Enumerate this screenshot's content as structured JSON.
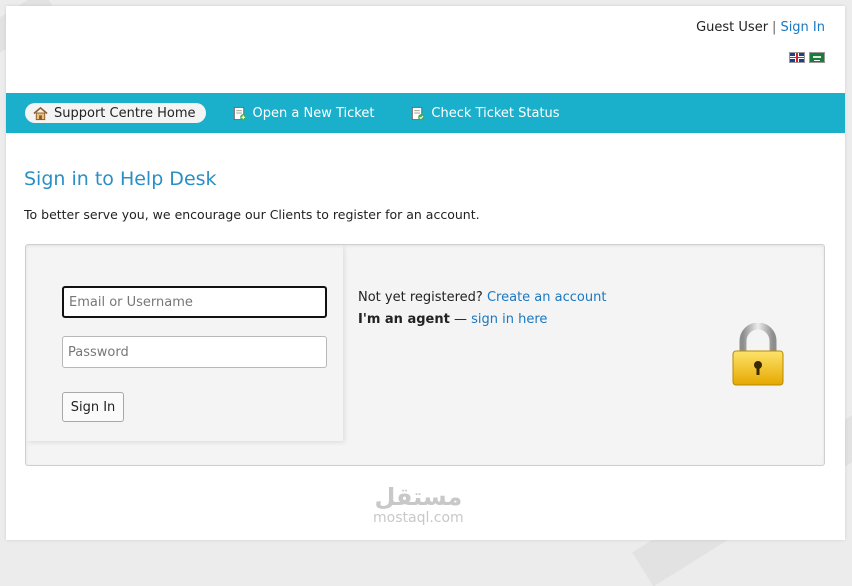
{
  "header": {
    "guest_label": "Guest User",
    "separator": "|",
    "signin_link": "Sign In"
  },
  "languages": [
    {
      "name": "uk-flag-icon"
    },
    {
      "name": "saudi-flag-icon"
    }
  ],
  "nav": {
    "items": [
      {
        "label": "Support Centre Home",
        "icon": "home-icon",
        "active": true
      },
      {
        "label": "Open a New Ticket",
        "icon": "new-ticket-icon",
        "active": false
      },
      {
        "label": "Check Ticket Status",
        "icon": "ticket-status-icon",
        "active": false
      }
    ]
  },
  "main": {
    "title": "Sign in to Help Desk",
    "intro": "To better serve you, we encourage our Clients to register for an account."
  },
  "login": {
    "username_placeholder": "Email or Username",
    "password_placeholder": "Password",
    "submit_label": "Sign In",
    "not_registered": "Not yet registered?",
    "create_account": "Create an account",
    "agent_label": "I'm an agent",
    "agent_dash": "—",
    "agent_link": "sign in here"
  },
  "watermark": {
    "arabic": "مستقل",
    "latin": "mostaql.com"
  },
  "colors": {
    "navbar": "#1ab0cc",
    "link": "#1a78c2",
    "title": "#2a8fc6",
    "lock_body": "#f5c419",
    "lock_shackle": "#b5b5b5"
  }
}
